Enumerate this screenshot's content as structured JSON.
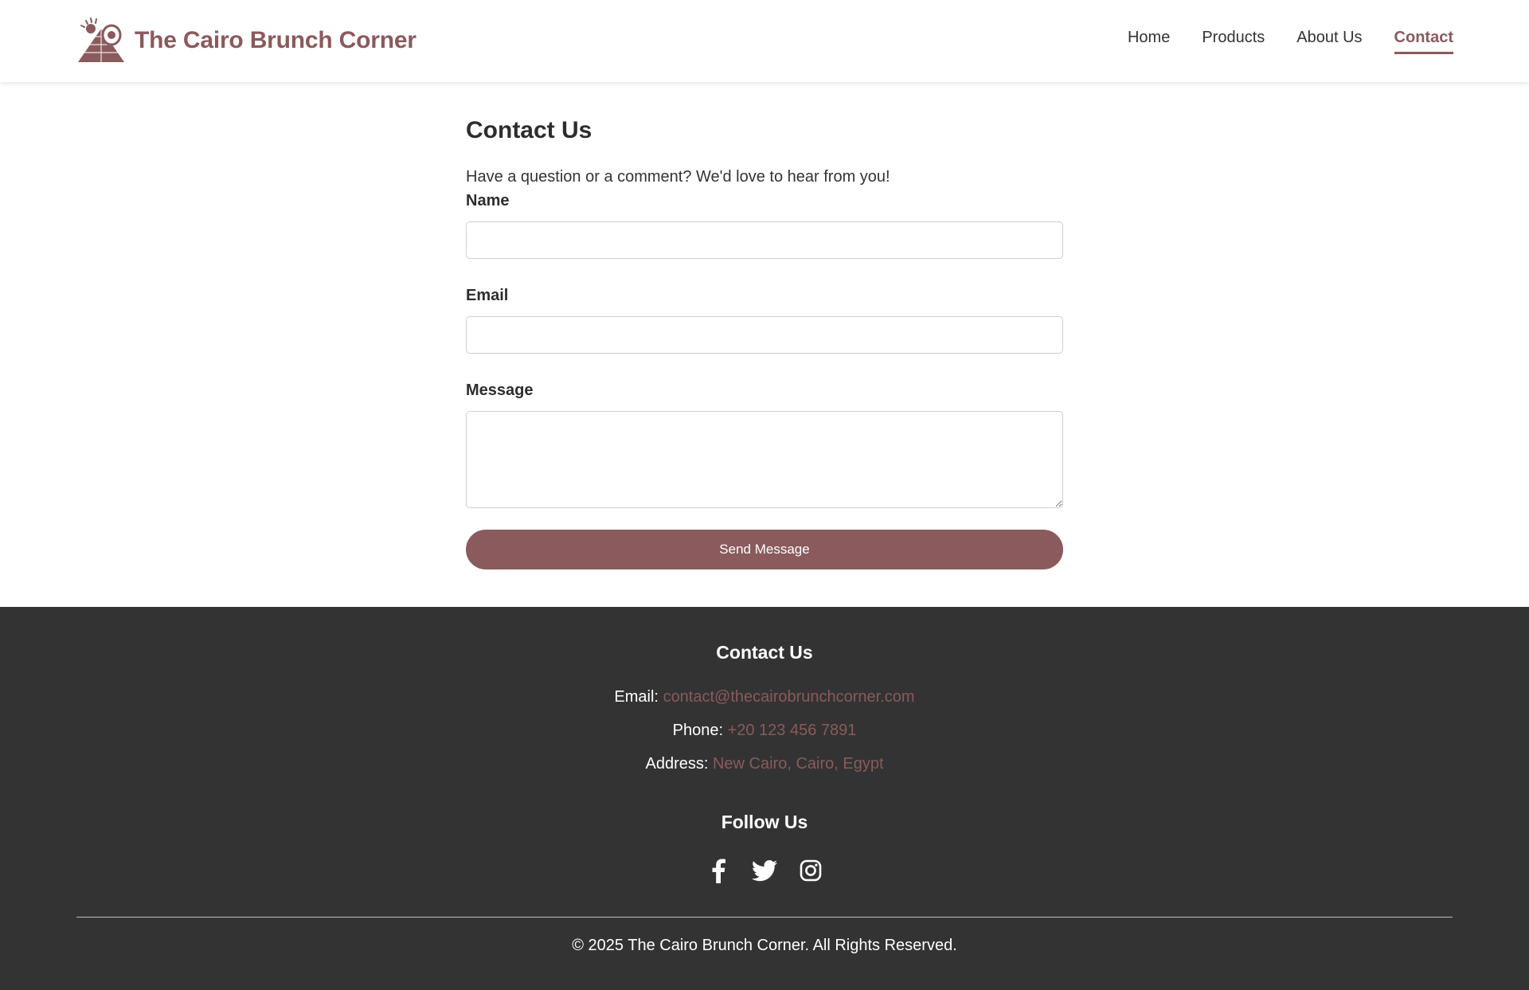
{
  "header": {
    "brand_name": "The Cairo Brunch Corner",
    "nav": [
      {
        "label": "Home",
        "active": false
      },
      {
        "label": "Products",
        "active": false
      },
      {
        "label": "About Us",
        "active": false
      },
      {
        "label": "Contact",
        "active": true
      }
    ]
  },
  "main": {
    "title": "Contact Us",
    "intro": "Have a question or a comment? We'd love to hear from you!",
    "fields": {
      "name": {
        "label": "Name",
        "value": "",
        "placeholder": ""
      },
      "email": {
        "label": "Email",
        "value": "",
        "placeholder": ""
      },
      "message": {
        "label": "Message",
        "value": "",
        "placeholder": ""
      }
    },
    "submit_label": "Send Message"
  },
  "footer": {
    "contact_heading": "Contact Us",
    "email_label": "Email:",
    "email_value": "contact@thecairobrunchcorner.com",
    "phone_label": "Phone:",
    "phone_value": "+20 123 456 7891",
    "address_label": "Address:",
    "address_value": "New Cairo, Cairo, Egypt",
    "follow_heading": "Follow Us",
    "socials": [
      "facebook-icon",
      "twitter-icon",
      "instagram-icon"
    ],
    "copyright": "© 2025 The Cairo Brunch Corner. All Rights Reserved."
  },
  "colors": {
    "accent": "#8a5a5c",
    "footer_bg": "#333333",
    "text": "#333333"
  }
}
